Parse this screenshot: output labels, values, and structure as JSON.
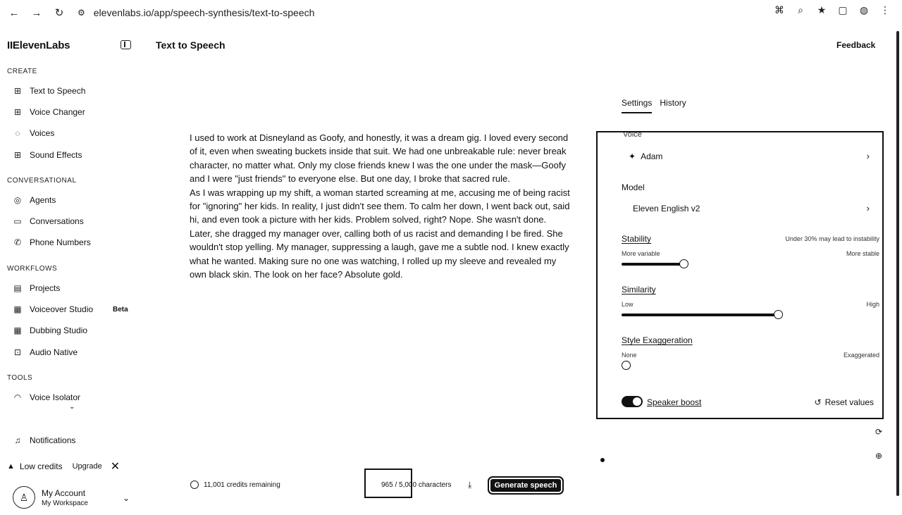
{
  "browser": {
    "url": "elevenlabs.io/app/speech-synthesis/text-to-speech",
    "icons": [
      "back-icon",
      "forward-icon",
      "reload-icon",
      "site-settings-icon",
      "translate-icon",
      "zoom-icon",
      "star-icon",
      "extensions-icon",
      "profile-icon",
      "menu-icon"
    ]
  },
  "sidebar": {
    "logo": "IIElevenLabs",
    "sections": {
      "create": "CREATE",
      "conversational": "CONVERSATIONAL",
      "workflows": "WORKFLOWS",
      "tools": "TOOLS"
    },
    "items": {
      "tts": "Text to Speech",
      "voice_changer": "Voice Changer",
      "voices": "Voices",
      "sound_effects": "Sound Effects",
      "agents": "Agents",
      "conversations": "Conversations",
      "phone_numbers": "Phone Numbers",
      "projects": "Projects",
      "voiceover_studio": "Voiceover Studio",
      "dubbing_studio": "Dubbing Studio",
      "audio_native": "Audio Native",
      "voice_isolator": "Voice Isolator",
      "notifications": "Notifications"
    },
    "beta_badge": "Beta",
    "low_credits": "Low credits",
    "upgrade": "Upgrade",
    "account_name": "My Account",
    "workspace": "My Workspace"
  },
  "header": {
    "title": "Text to Speech",
    "feedback": "Feedback"
  },
  "editor": {
    "para1": "I used to work at Disneyland as Goofy, and honestly, it was a dream gig. I loved every second of it, even when sweating buckets inside that suit. We had one unbreakable rule: never break character, no matter what. Only my close friends knew I was the one under the mask—Goofy and I were \"just friends\" to everyone else. But one day, I broke that sacred rule.",
    "para2": "As I was wrapping up my shift, a woman started screaming at me, accusing me of being racist for \"ignoring\" her kids. In reality, I just didn't see them. To calm her down, I went back out, said hi, and even took a picture with her kids. Problem solved, right? Nope. She wasn't done. Later, she dragged my manager over, calling both of us racist and demanding I be fired. She wouldn't stop yelling. My manager, suppressing a laugh, gave me a subtle nod. I knew exactly what he wanted. Making sure no one was watching, I rolled up my sleeve and revealed my own black skin. The look on her face? Absolute gold."
  },
  "tabs": {
    "settings": "Settings",
    "history": "History"
  },
  "settings": {
    "voice_label": "Voice",
    "voice_value": "Adam",
    "model_label": "Model",
    "model_value": "Eleven English v2",
    "stability": {
      "label": "Stability",
      "hint": "Under 30% may lead to instability",
      "min_label": "More variable",
      "max_label": "More stable",
      "value": 0.3
    },
    "similarity": {
      "label": "Similarity",
      "min_label": "Low",
      "max_label": "High",
      "value": 0.75
    },
    "style": {
      "label": "Style Exaggeration",
      "min_label": "None",
      "max_label": "Exaggerated",
      "value": 0
    },
    "speaker_boost": "Speaker boost",
    "speaker_boost_on": true,
    "reset": "Reset values"
  },
  "footer": {
    "credits": "11,001 credits remaining",
    "char_count": "965 / 5,000 characters",
    "generate": "Generate speech"
  }
}
